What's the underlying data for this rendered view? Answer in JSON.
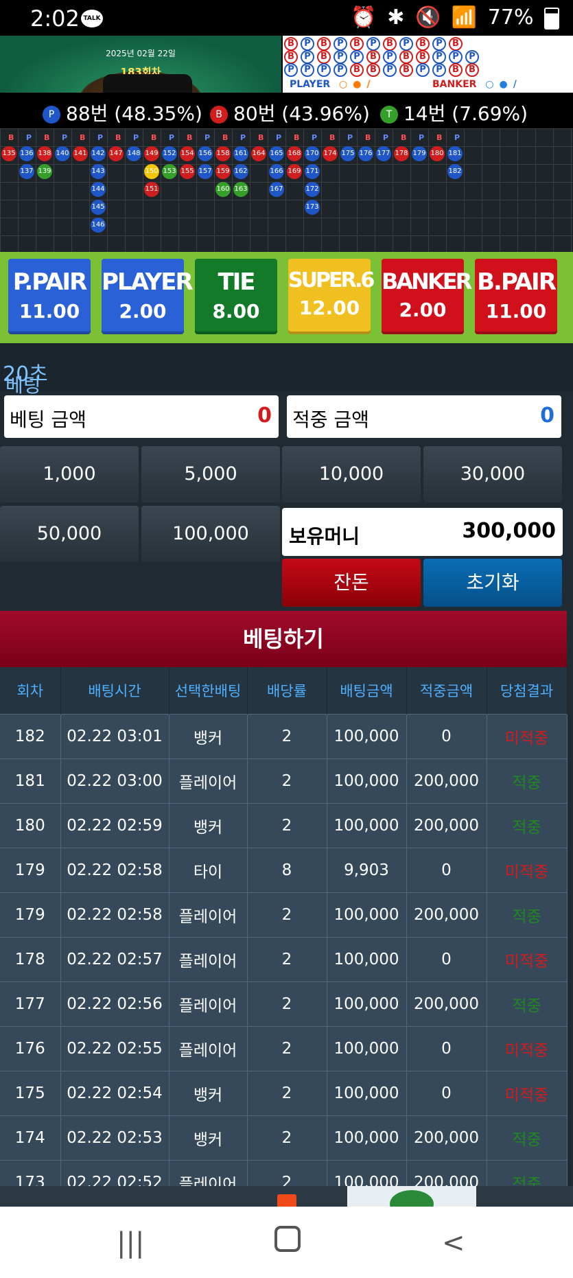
{
  "status_bar": {
    "time": "2:02",
    "talk_badge": "TALK",
    "battery": "77%"
  },
  "table_video": {
    "date": "2025년 02월 22일",
    "round": "183회차"
  },
  "scoreboard": {
    "bead_rows": [
      [
        "B",
        "P",
        "B",
        "P",
        "B",
        "P",
        "B",
        "P",
        "B",
        "P",
        "B"
      ],
      [
        "B",
        "P",
        "B",
        "P",
        "P",
        "B",
        "P",
        "B",
        "B",
        "P",
        "P",
        "P"
      ],
      [
        "P",
        "P",
        "P",
        "P",
        "B",
        "B",
        "P",
        "B",
        "P",
        "P",
        "B",
        "B"
      ]
    ],
    "player_label": "PLAYER",
    "banker_label": "BANKER"
  },
  "stats": [
    {
      "badge": "P",
      "text": "88번 (48.35%)",
      "color": "#1f57c9"
    },
    {
      "badge": "B",
      "text": "80번 (43.96%)",
      "color": "#d01d1d"
    },
    {
      "badge": "T",
      "text": "14번 (7.69%)",
      "color": "#34a02a"
    }
  ],
  "roadmap": {
    "headers": [
      "B",
      "P",
      "B",
      "P",
      "B",
      "P",
      "B",
      "P",
      "B",
      "P",
      "B",
      "P",
      "B",
      "P",
      "B",
      "P",
      "B",
      "P",
      "B",
      "P",
      "B",
      "P",
      "B",
      "P",
      "B",
      "P"
    ],
    "columns": [
      [
        [
          "135",
          "B"
        ]
      ],
      [
        [
          "136",
          "P"
        ],
        [
          "137",
          "P"
        ]
      ],
      [
        [
          "138",
          "B"
        ],
        [
          "139",
          "T"
        ]
      ],
      [
        [
          "140",
          "P"
        ]
      ],
      [
        [
          "141",
          "B"
        ]
      ],
      [
        [
          "142",
          "P"
        ],
        [
          "143",
          "P"
        ],
        [
          "144",
          "P"
        ],
        [
          "145",
          "P"
        ],
        [
          "146",
          "P"
        ]
      ],
      [
        [
          "147",
          "B"
        ]
      ],
      [
        [
          "148",
          "P"
        ]
      ],
      [
        [
          "149",
          "B"
        ],
        [
          "150",
          "S"
        ],
        [
          "151",
          "B"
        ]
      ],
      [
        [
          "152",
          "P"
        ],
        [
          "153",
          "T"
        ]
      ],
      [
        [
          "154",
          "B"
        ],
        [
          "155",
          "B"
        ]
      ],
      [
        [
          "156",
          "P"
        ],
        [
          "157",
          "P"
        ]
      ],
      [
        [
          "158",
          "B"
        ],
        [
          "159",
          "B"
        ],
        [
          "160",
          "T"
        ]
      ],
      [
        [
          "161",
          "P"
        ],
        [
          "162",
          "P"
        ],
        [
          "163",
          "T"
        ]
      ],
      [
        [
          "164",
          "B"
        ]
      ],
      [
        [
          "165",
          "P"
        ],
        [
          "166",
          "P"
        ],
        [
          "167",
          "P"
        ]
      ],
      [
        [
          "168",
          "B"
        ],
        [
          "169",
          "B"
        ]
      ],
      [
        [
          "170",
          "P"
        ],
        [
          "171",
          "P"
        ],
        [
          "172",
          "P"
        ],
        [
          "173",
          "P"
        ]
      ],
      [
        [
          "174",
          "B"
        ]
      ],
      [
        [
          "175",
          "P"
        ]
      ],
      [
        [
          "176",
          "P"
        ]
      ],
      [
        [
          "177",
          "P"
        ]
      ],
      [
        [
          "178",
          "B"
        ]
      ],
      [
        [
          "179",
          "P"
        ]
      ],
      [
        [
          "180",
          "B"
        ]
      ],
      [
        [
          "181",
          "P"
        ],
        [
          "182",
          "P"
        ]
      ]
    ]
  },
  "bet_options": [
    {
      "name": "P.PAIR",
      "odds": "11.00",
      "color": "#2b61d6"
    },
    {
      "name": "PLAYER",
      "odds": "2.00",
      "color": "#2b61d6"
    },
    {
      "name": "TIE",
      "odds": "8.00",
      "color": "#137a2a"
    },
    {
      "name": "SUPER.6",
      "odds": "12.00",
      "color": "#f0c020"
    },
    {
      "name": "BANKER",
      "odds": "2.00",
      "color": "#d0111b"
    },
    {
      "name": "B.PAIR",
      "odds": "11.00",
      "color": "#d0111b"
    }
  ],
  "timer": {
    "label": "베팅가능",
    "seconds": "20초"
  },
  "bet_amount": {
    "label": "베팅 금액",
    "value": "0"
  },
  "win_amount": {
    "label": "적중 금액",
    "value": "0"
  },
  "chips": [
    "1,000",
    "5,000",
    "10,000",
    "30,000",
    "50,000",
    "100,000"
  ],
  "wallet": {
    "label": "보유머니",
    "value": "300,000"
  },
  "actions": {
    "change": "잔돈",
    "reset": "초기화",
    "place_bet": "베팅하기"
  },
  "history": {
    "headers": [
      "회차",
      "배팅시간",
      "선택한배팅",
      "배당률",
      "배팅금액",
      "적중금액",
      "당첨결과"
    ],
    "rows": [
      [
        "182",
        "02.22 03:01",
        "뱅커",
        "2",
        "100,000",
        "0",
        "미적중"
      ],
      [
        "181",
        "02.22 03:00",
        "플레이어",
        "2",
        "100,000",
        "200,000",
        "적중"
      ],
      [
        "180",
        "02.22 02:59",
        "뱅커",
        "2",
        "100,000",
        "200,000",
        "적중"
      ],
      [
        "179",
        "02.22 02:58",
        "타이",
        "8",
        "9,903",
        "0",
        "미적중"
      ],
      [
        "179",
        "02.22 02:58",
        "플레이어",
        "2",
        "100,000",
        "200,000",
        "적중"
      ],
      [
        "178",
        "02.22 02:57",
        "플레이어",
        "2",
        "100,000",
        "0",
        "미적중"
      ],
      [
        "177",
        "02.22 02:56",
        "플레이어",
        "2",
        "100,000",
        "200,000",
        "적중"
      ],
      [
        "176",
        "02.22 02:55",
        "플레이어",
        "2",
        "100,000",
        "0",
        "미적중"
      ],
      [
        "175",
        "02.22 02:54",
        "뱅커",
        "2",
        "100,000",
        "0",
        "미적중"
      ],
      [
        "174",
        "02.22 02:53",
        "뱅커",
        "2",
        "100,000",
        "200,000",
        "적중"
      ],
      [
        "173",
        "02.22 02:52",
        "플레이어",
        "2",
        "100,000",
        "200,000",
        "적중"
      ]
    ]
  },
  "nav": {
    "recent": "recent-apps-icon",
    "home": "home-icon",
    "back": "back-icon"
  }
}
